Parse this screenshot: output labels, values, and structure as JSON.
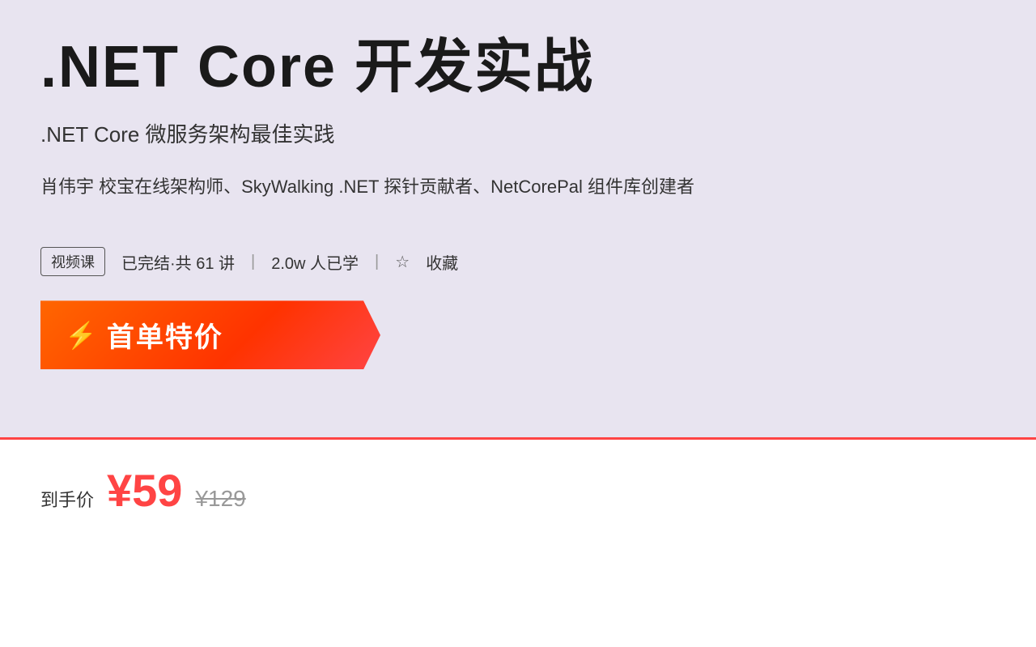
{
  "header": {
    "main_title": ".NET Core 开发实战",
    "subtitle": ".NET Core 微服务架构最佳实践",
    "author": "肖伟宇  校宝在线架构师、SkyWalking .NET 探针贡献者、NetCorePal 组件库创建者"
  },
  "meta": {
    "course_type": "视频课",
    "completion_status": "已完结·共 61 讲",
    "separator1": "|",
    "students": "2.0w 人已学",
    "separator2": "|",
    "favorite_label": "收藏"
  },
  "banner": {
    "label": "首单特价"
  },
  "pricing": {
    "label": "到手价",
    "current": "¥59",
    "original": "¥129"
  },
  "colors": {
    "background_top": "#e8e4f0",
    "accent_red": "#ff4444",
    "banner_orange": "#ff6600",
    "text_dark": "#1a1a1a",
    "text_medium": "#333333",
    "text_muted": "#999999"
  }
}
